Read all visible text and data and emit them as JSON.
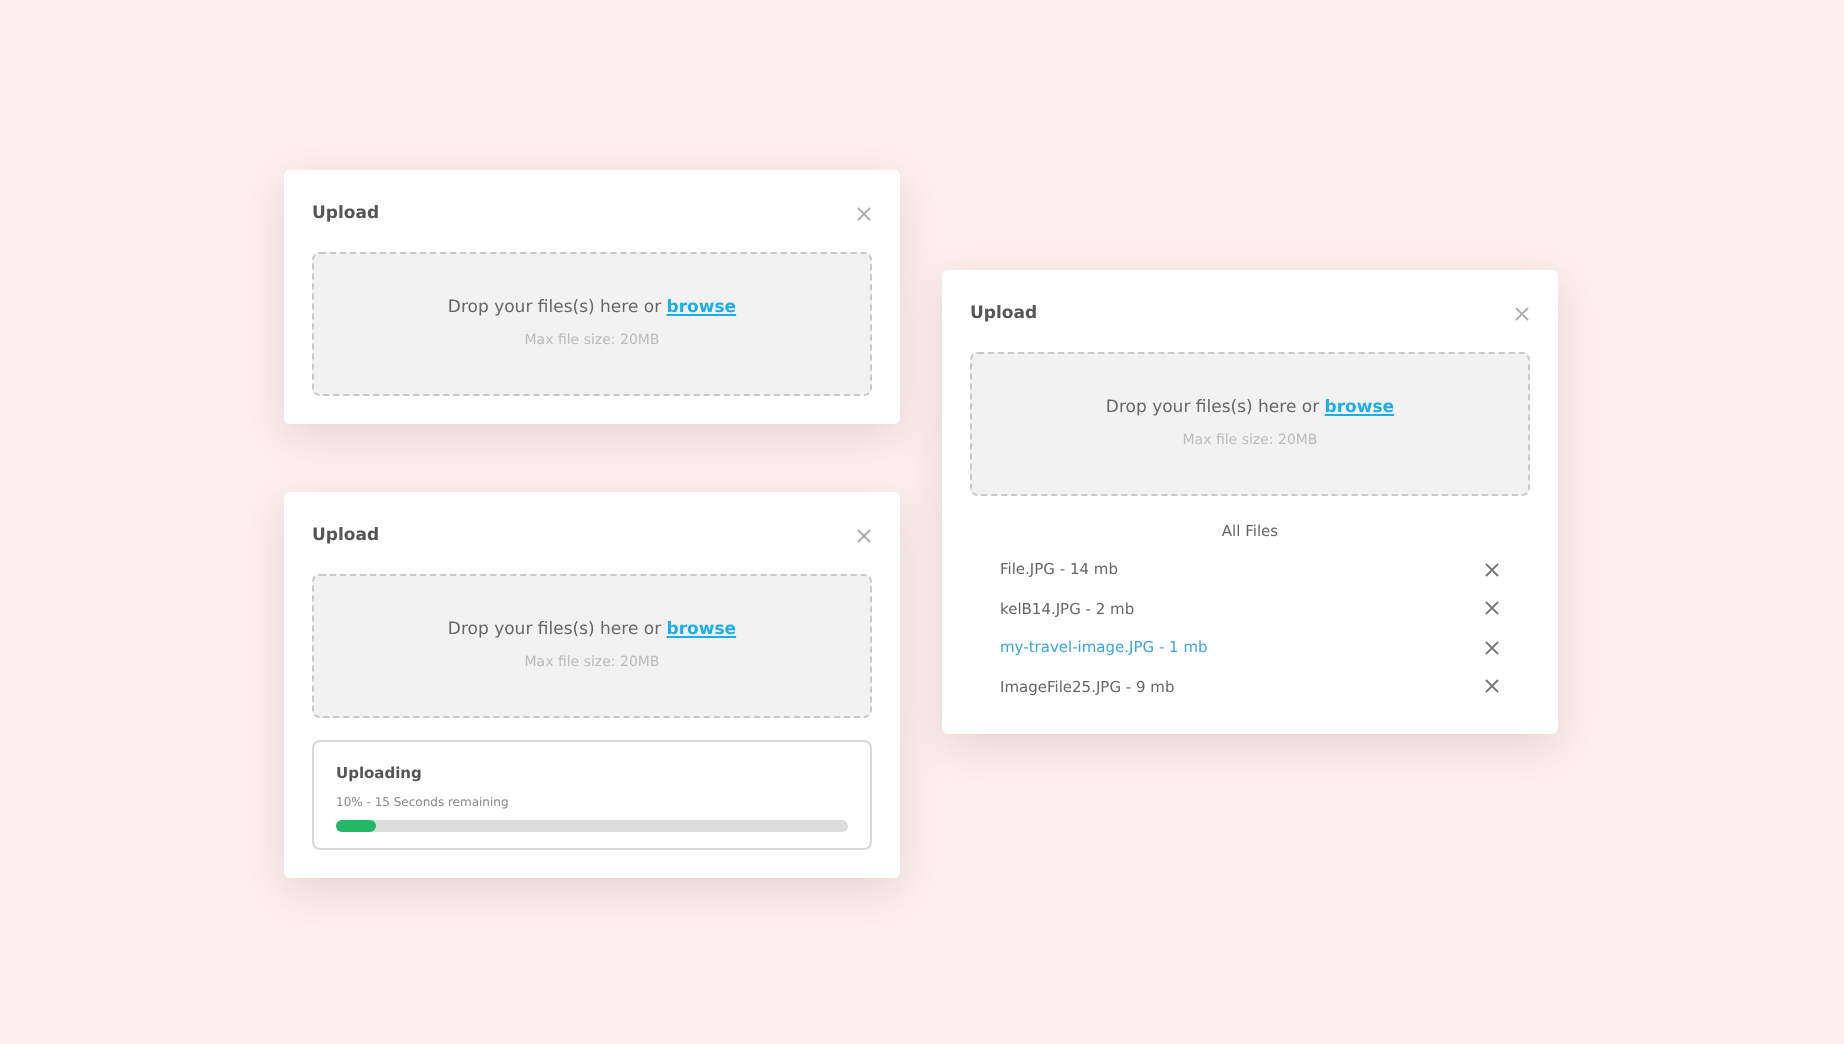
{
  "dialogs": [
    {
      "title": "Upload",
      "dropzone": {
        "prompt": "Drop your files(s) here or",
        "link": "browse",
        "hint": "Max file size: 20MB"
      }
    },
    {
      "title": "Upload",
      "dropzone": {
        "prompt": "Drop your files(s) here or",
        "link": "browse",
        "hint": "Max file size: 20MB"
      },
      "progress": {
        "title": "Uploading",
        "status": "10% - 15 Seconds remaining",
        "level": 0.08
      }
    },
    {
      "title": "Upload",
      "dropzone": {
        "prompt": "Drop your files(s) here or",
        "link": "browse",
        "hint": "Max file size: 20MB"
      },
      "files_heading": "All Files",
      "files": [
        {
          "name": "File.JPG - 14 mb",
          "selected": false
        },
        {
          "name": "kelB14.JPG - 2 mb",
          "selected": false
        },
        {
          "name": "my-travel-image.JPG - 1 mb",
          "selected": true
        },
        {
          "name": "ImageFile25.JPG - 9 mb",
          "selected": false
        }
      ]
    }
  ]
}
